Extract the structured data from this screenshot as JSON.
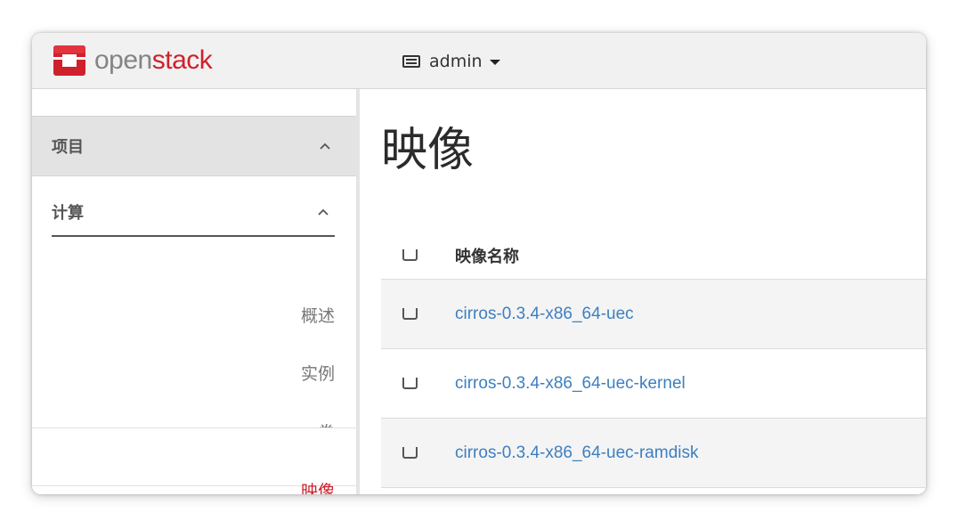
{
  "topbar": {
    "logo": {
      "text_open": "open",
      "text_stack": "stack"
    },
    "project_switcher": {
      "label": "admin",
      "icon": "project-card-icon"
    }
  },
  "sidebar": {
    "panel": {
      "label": "项目",
      "icon": "chevron-up-icon"
    },
    "group": {
      "label": "计算",
      "icon": "chevron-up-icon"
    },
    "items": [
      {
        "label": "概述",
        "active": false
      },
      {
        "label": "实例",
        "active": false
      },
      {
        "label": "卷",
        "active": false
      },
      {
        "label": "映像",
        "active": true
      }
    ]
  },
  "main": {
    "title": "映像",
    "table": {
      "columns": [
        "映像名称"
      ],
      "rows": [
        {
          "name": "cirros-0.3.4-x86_64-uec"
        },
        {
          "name": "cirros-0.3.4-x86_64-uec-kernel"
        },
        {
          "name": "cirros-0.3.4-x86_64-uec-ramdisk"
        }
      ]
    }
  },
  "colors": {
    "brand_red": "#d0202c",
    "link_blue": "#3d7fc1",
    "topbar_bg": "#f1f1f1",
    "sidebar_panel_bg": "#e3e3e3"
  }
}
